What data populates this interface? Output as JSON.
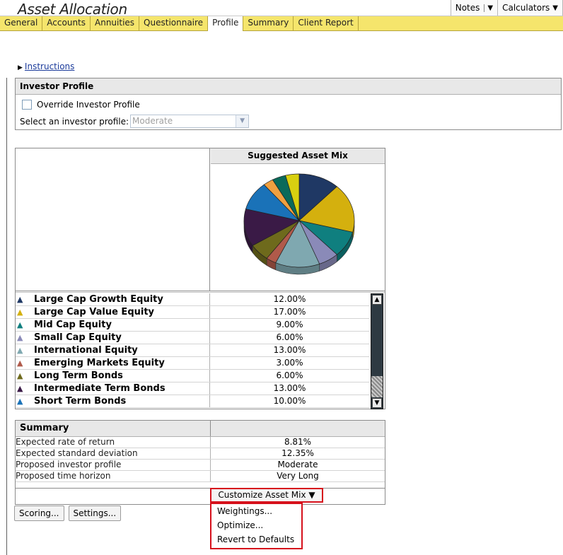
{
  "app": {
    "title": "Asset Allocation"
  },
  "top_buttons": {
    "notes": "Notes",
    "calculators": "Calculators"
  },
  "tabs": [
    "General",
    "Accounts",
    "Annuities",
    "Questionnaire",
    "Profile",
    "Summary",
    "Client Report"
  ],
  "active_tab": "Profile",
  "instructions_link": "Instructions",
  "investor_profile": {
    "heading": "Investor Profile",
    "override_label": "Override Investor Profile",
    "override_checked": false,
    "select_label": "Select an investor profile:",
    "select_value": "Moderate"
  },
  "asset_mix": {
    "heading": "Suggested Asset Mix",
    "rows": [
      {
        "name": "Large Cap Growth Equity",
        "value": "12.00%",
        "color": "#1f3864"
      },
      {
        "name": "Large Cap Value Equity",
        "value": "17.00%",
        "color": "#d4b00e"
      },
      {
        "name": "Mid Cap Equity",
        "value": "9.00%",
        "color": "#0f7f7f"
      },
      {
        "name": "Small Cap Equity",
        "value": "6.00%",
        "color": "#8a8ab8"
      },
      {
        "name": "International Equity",
        "value": "13.00%",
        "color": "#7fa8b0"
      },
      {
        "name": "Emerging Markets Equity",
        "value": "3.00%",
        "color": "#b05a4a"
      },
      {
        "name": "Long Term Bonds",
        "value": "6.00%",
        "color": "#6e6a1c"
      },
      {
        "name": "Intermediate Term Bonds",
        "value": "13.00%",
        "color": "#3a1a46"
      },
      {
        "name": "Short Term Bonds",
        "value": "10.00%",
        "color": "#1a72b8"
      }
    ],
    "unlisted_slices": [
      {
        "color": "#f0a040",
        "value": 3
      },
      {
        "color": "#0a6a5a",
        "value": 4
      },
      {
        "color": "#d8d010",
        "value": 4
      }
    ]
  },
  "summary": {
    "heading": "Summary",
    "rows": [
      {
        "label": "Expected rate of return",
        "value": "8.81%"
      },
      {
        "label": "Expected standard deviation",
        "value": "12.35%"
      },
      {
        "label": "Proposed investor profile",
        "value": "Moderate"
      },
      {
        "label": "Proposed time horizon",
        "value": "Very Long"
      }
    ]
  },
  "customize": {
    "label": "Customize Asset Mix",
    "menu": [
      "Weightings...",
      "Optimize...",
      "Revert to Defaults"
    ]
  },
  "buttons": {
    "scoring": "Scoring...",
    "settings": "Settings..."
  }
}
